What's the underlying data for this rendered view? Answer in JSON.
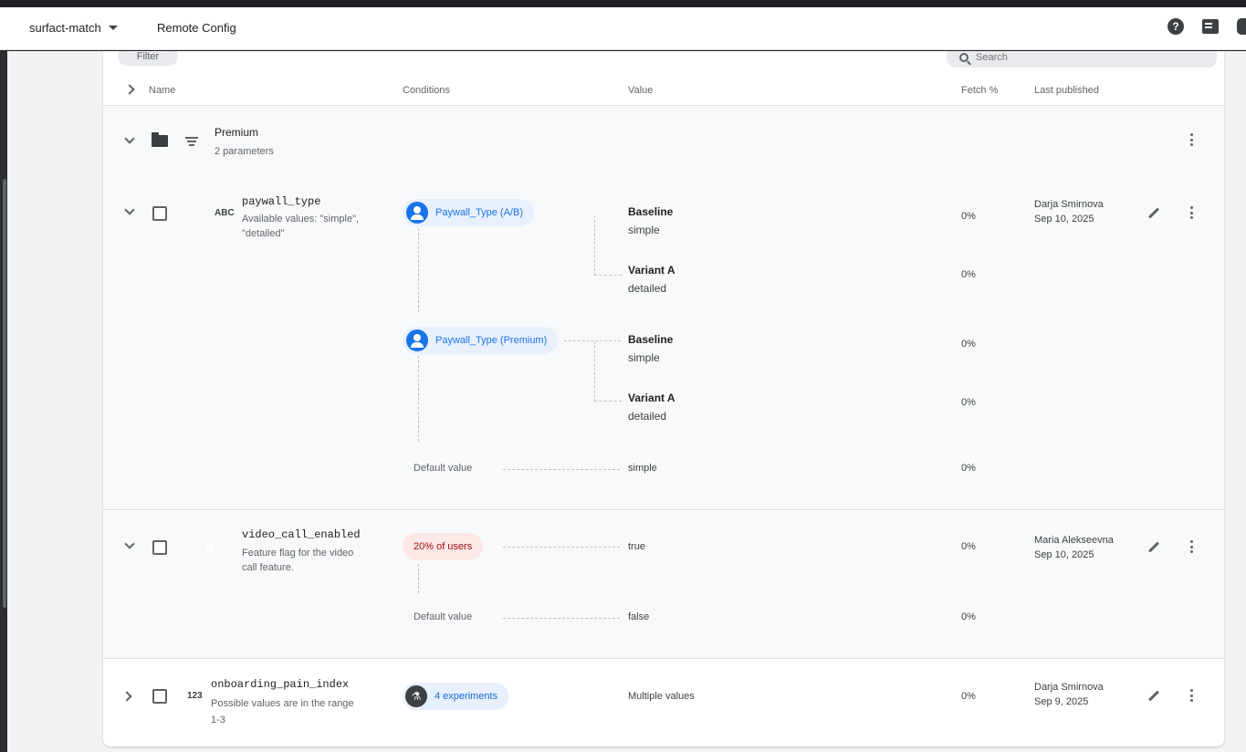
{
  "topbar": {
    "project": "surfact-match",
    "config_title": "Remote Config",
    "help_label": "?"
  },
  "toolbar": {
    "filter_chip": "Filter",
    "search_placeholder": "Search"
  },
  "table": {
    "headers": {
      "name": "Name",
      "conditions": "Conditions",
      "value": "Value",
      "fetch": "Fetch %",
      "published": "Last published"
    }
  },
  "group": {
    "title": "Premium",
    "subtitle": "2 parameters"
  },
  "params": [
    {
      "type_badge": "ABC",
      "name": "paywall_type",
      "description_1": "Available values: \"simple\",",
      "description_2": "\"detailed\"",
      "conditions": [
        {
          "label": "Paywall_Type (A/B)",
          "values": [
            {
              "bold": "Baseline",
              "sub": "simple",
              "fetch": "0%"
            },
            {
              "bold": "Variant A",
              "sub": "detailed",
              "fetch": "0%"
            }
          ]
        },
        {
          "label": "Paywall_Type (Premium)",
          "values": [
            {
              "bold": "Baseline",
              "sub": "simple",
              "fetch": "0%"
            },
            {
              "bold": "Variant A",
              "sub": "detailed",
              "fetch": "0%"
            }
          ]
        }
      ],
      "default_label": "Default value",
      "default_value": "simple",
      "default_fetch": "0%",
      "published_by": "Darja Smirnova",
      "published_date": "Sep 10, 2025"
    },
    {
      "name": "video_call_enabled",
      "description_1": "Feature flag for the video",
      "description_2": "call feature.",
      "condition_pill": "20% of users",
      "condition_value": "true",
      "condition_fetch": "0%",
      "default_label": "Default value",
      "default_value": "false",
      "default_fetch": "0%",
      "published_by": "Maria Alekseevna",
      "published_date": "Sep 10, 2025"
    },
    {
      "type_badge": "123",
      "name": "onboarding_pain_index",
      "description_1": "Possible values are in the range",
      "description_2": "1-3",
      "experiment_pill": "4 experiments",
      "value": "Multiple values",
      "fetch": "0%",
      "published_by": "Darja Smirnova",
      "published_date": "Sep 9, 2025"
    }
  ],
  "colors": {
    "accent": "#1a73e8",
    "pill_blue_bg": "#e8f0fe",
    "pill_red_bg": "#fce8e6",
    "pill_red_text": "#a50e0e"
  }
}
